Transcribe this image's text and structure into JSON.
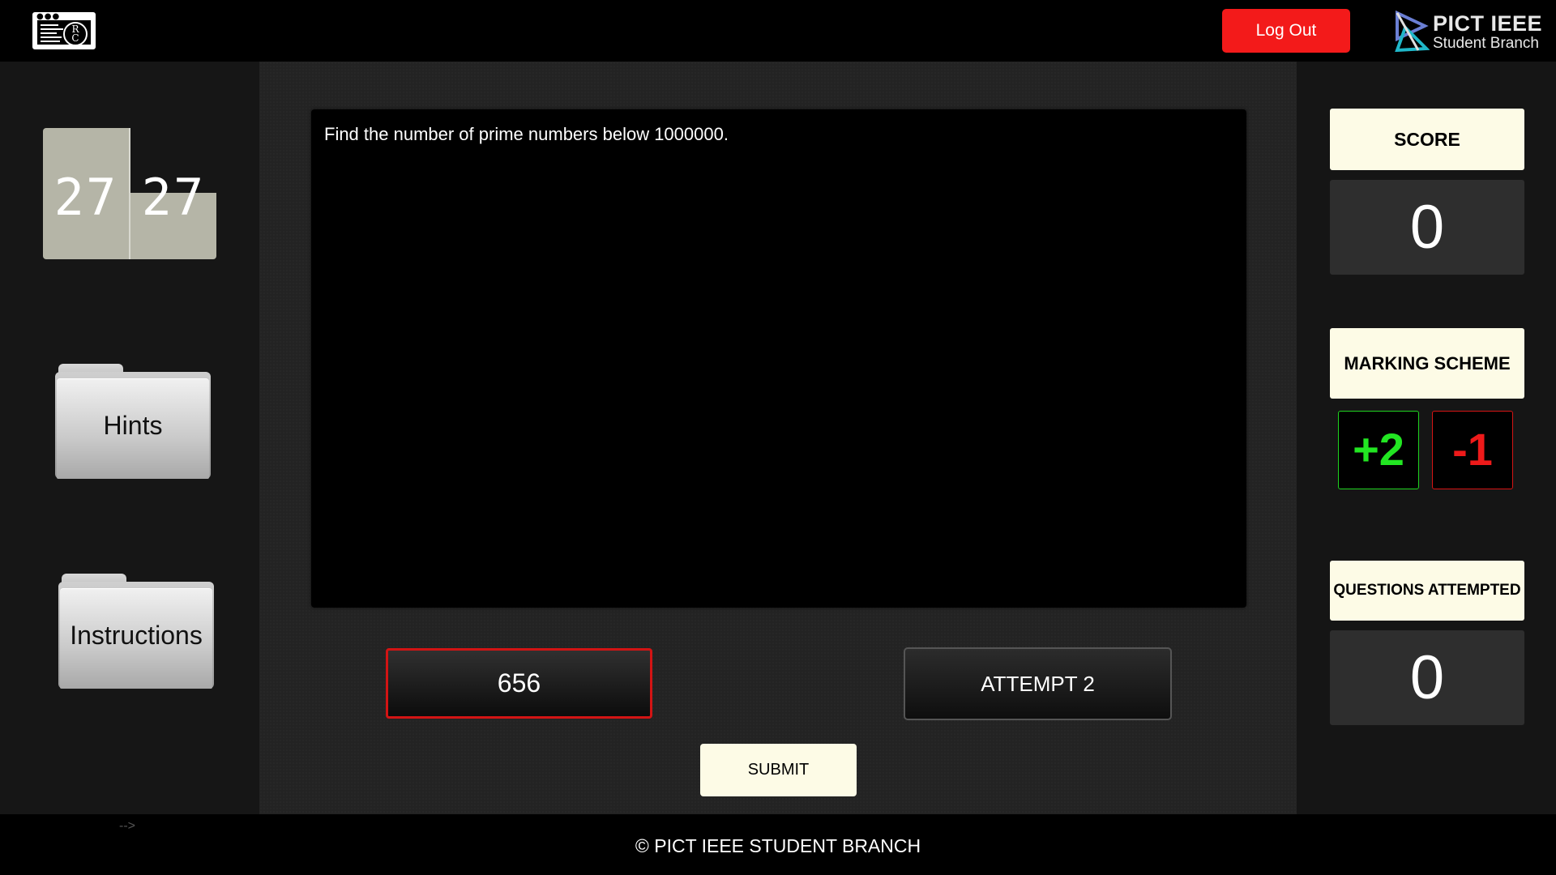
{
  "header": {
    "logout_label": "Log Out",
    "brand_title": "PICT IEEE",
    "brand_subtitle": "Student Branch"
  },
  "timer": {
    "minutes": "27",
    "seconds": "27"
  },
  "sidebar": {
    "hints_label": "Hints",
    "instructions_label": "Instructions"
  },
  "question": {
    "text": "Find the number of prime numbers below 1000000."
  },
  "answer": {
    "value": "656",
    "attempt_label": "ATTEMPT 2",
    "submit_label": "SUBMIT"
  },
  "stats": {
    "score_label": "SCORE",
    "score_value": "0",
    "marking_label": "MARKING SCHEME",
    "marking_positive": "+2",
    "marking_negative": "-1",
    "questions_label": "QUESTIONS ATTEMPTED",
    "questions_value": "0"
  },
  "footer": {
    "stray_text": "-->",
    "copyright": "© PICT IEEE STUDENT BRANCH"
  },
  "colors": {
    "logout": "#f31a1a",
    "positive": "#22e622",
    "negative": "#ee1a1a",
    "label_card": "#fdfbe6",
    "timer_block": "#b5b5a7"
  }
}
